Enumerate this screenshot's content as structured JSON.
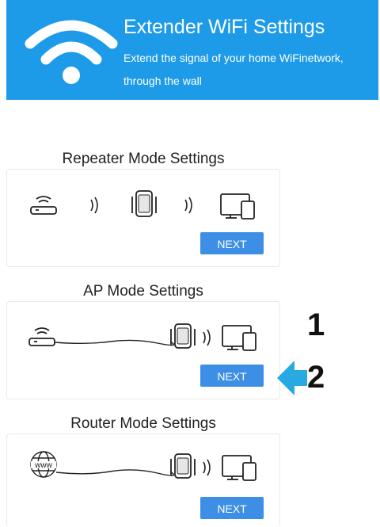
{
  "header": {
    "title": "Extender WiFi Settings",
    "subtitle_line1": "Extend the signal of your home WiFinetwork,",
    "subtitle_line2": "through the wall",
    "icon": "wifi-icon",
    "background_color": "#1e9be8"
  },
  "modes": [
    {
      "title": "Repeater Mode Settings",
      "button_label": "NEXT",
      "icons": [
        "router-icon",
        "signal-icon",
        "extender-icon",
        "signal-icon",
        "devices-icon"
      ]
    },
    {
      "title": "AP Mode Settings",
      "button_label": "NEXT",
      "icons": [
        "router-icon",
        "cable-icon",
        "extender-icon",
        "signal-icon",
        "devices-icon"
      ]
    },
    {
      "title": "Router Mode Settings",
      "button_label": "NEXT",
      "icons": [
        "globe-icon",
        "cable-icon",
        "extender-icon",
        "signal-icon",
        "devices-icon"
      ]
    }
  ],
  "annotations": {
    "step1": "1",
    "step2": "2",
    "arrow_color": "#29a9e1"
  },
  "button_color": "#3d8fe6"
}
